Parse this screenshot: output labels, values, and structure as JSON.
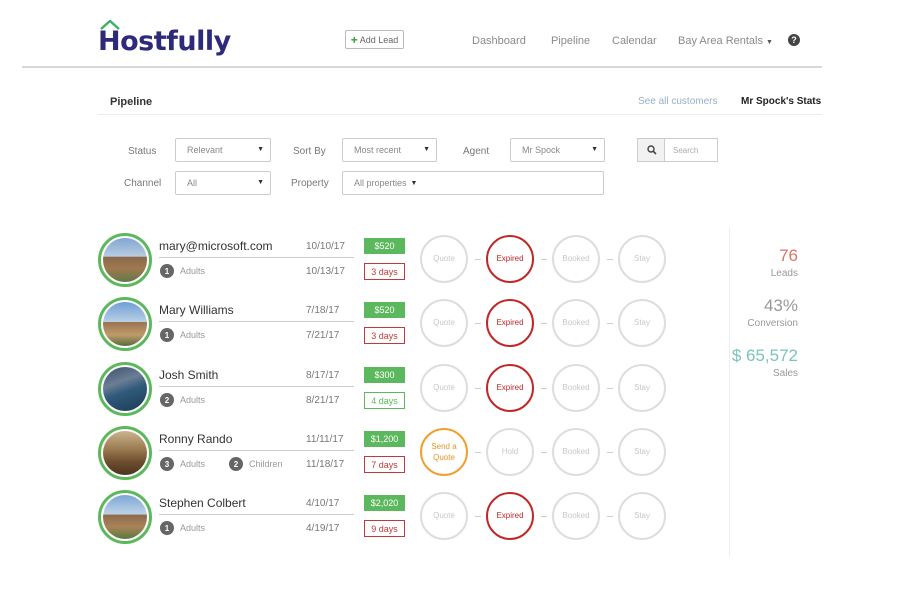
{
  "header": {
    "logo": "Hostfully",
    "add_lead": "Add Lead",
    "nav": [
      "Dashboard",
      "Pipeline",
      "Calendar"
    ],
    "property_dropdown": "Bay Area Rentals",
    "help_icon": "question-circle-icon"
  },
  "subheader": {
    "title": "Pipeline",
    "see_all": "See all customers",
    "stats_link": "Mr Spock's Stats"
  },
  "filters": {
    "status_label": "Status",
    "status_value": "Relevant",
    "sortby_label": "Sort By",
    "sortby_value": "Most recent",
    "agent_label": "Agent",
    "agent_value": "Mr Spock",
    "search_placeholder": "Search",
    "channel_label": "Channel",
    "channel_value": "All",
    "property_label": "Property",
    "property_value": "All properties"
  },
  "leads": [
    {
      "name": "mary@microsoft.com",
      "adults": "1",
      "adults_label": "Adults",
      "children": "",
      "children_label": "",
      "date_in": "10/10/17",
      "date_out": "10/13/17",
      "price": "$520",
      "days": "3 days",
      "days_color": "red",
      "stages": [
        "Quote",
        "Expired",
        "Booked",
        "Stay"
      ]
    },
    {
      "name": "Mary Williams",
      "adults": "1",
      "adults_label": "Adults",
      "children": "",
      "children_label": "",
      "date_in": "7/18/17",
      "date_out": "7/21/17",
      "price": "$520",
      "days": "3 days",
      "days_color": "red",
      "stages": [
        "Quote",
        "Expired",
        "Booked",
        "Stay"
      ]
    },
    {
      "name": "Josh Smith",
      "adults": "2",
      "adults_label": "Adults",
      "children": "",
      "children_label": "",
      "date_in": "8/17/17",
      "date_out": "8/21/17",
      "price": "$300",
      "days": "4 days",
      "days_color": "green",
      "stages": [
        "Quote",
        "Expired",
        "Booked",
        "Stay"
      ]
    },
    {
      "name": "Ronny Rando",
      "adults": "3",
      "adults_label": "Adults",
      "children": "2",
      "children_label": "Children",
      "date_in": "11/11/17",
      "date_out": "11/18/17",
      "price": "$1,200",
      "days": "7 days",
      "days_color": "red",
      "stages": [
        "Send a Quote",
        "Hold",
        "Booked",
        "Stay"
      ]
    },
    {
      "name": "Stephen Colbert",
      "adults": "1",
      "adults_label": "Adults",
      "children": "",
      "children_label": "",
      "date_in": "4/10/17",
      "date_out": "4/19/17",
      "price": "$2,020",
      "days": "9 days",
      "days_color": "red",
      "stages": [
        "Quote",
        "Expired",
        "Booked",
        "Stay"
      ]
    }
  ],
  "stats": {
    "leads_value": "76",
    "leads_label": "Leads",
    "conversion_value": "43%",
    "conversion_label": "Conversion",
    "sales_value": "$ 65,572",
    "sales_label": "Sales"
  },
  "colors": {
    "brand": "#2d2a7a",
    "green": "#5cb85c",
    "expired": "#c02828",
    "quote_orange": "#f0a030",
    "leads_stat": "#d9746a",
    "sales_stat": "#7cc3ba"
  }
}
